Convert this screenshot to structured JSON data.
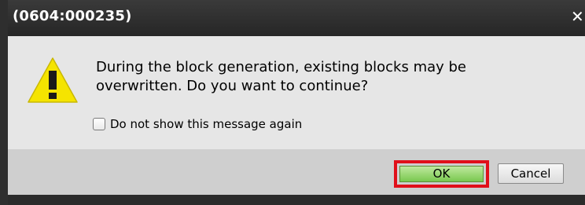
{
  "dialog": {
    "title": "(0604:000235)",
    "close_icon": "close-icon",
    "message_line1": "During the block generation, existing blocks may be",
    "message_line2": "overwritten. Do you want to continue?",
    "warning_icon": "warning-icon",
    "checkbox_label": "Do not show this message again",
    "checkbox_checked": false,
    "ok_label": "OK",
    "cancel_label": "Cancel",
    "ok_highlight_color": "#e0101a",
    "ok_button_color": "#79c84f"
  }
}
